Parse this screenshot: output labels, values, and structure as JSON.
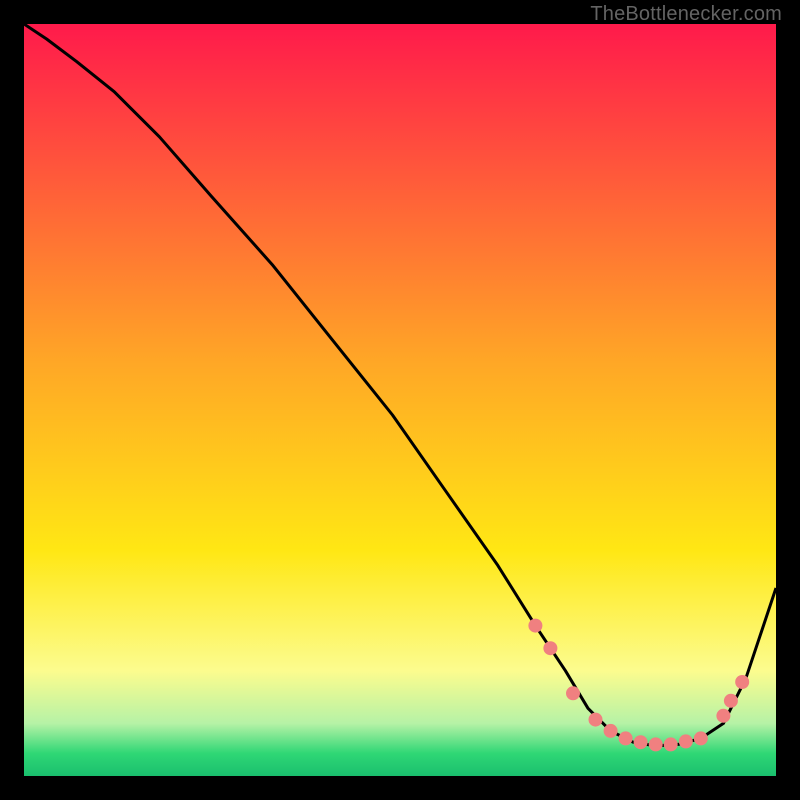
{
  "attribution": "TheBottlenecker.com",
  "chart_data": {
    "type": "line",
    "title": "",
    "xlabel": "",
    "ylabel": "",
    "xlim": [
      0,
      100
    ],
    "ylim": [
      0,
      100
    ],
    "background": {
      "gradient_stops": [
        {
          "pos": 0.0,
          "color": "#ff1a4b"
        },
        {
          "pos": 0.45,
          "color": "#ffa726"
        },
        {
          "pos": 0.7,
          "color": "#ffe714"
        },
        {
          "pos": 0.86,
          "color": "#fcfc8e"
        },
        {
          "pos": 0.93,
          "color": "#b6f2a6"
        },
        {
          "pos": 0.97,
          "color": "#2fd775"
        },
        {
          "pos": 1.0,
          "color": "#1abf6e"
        }
      ]
    },
    "series": [
      {
        "name": "curve",
        "color": "#000000",
        "x": [
          0,
          3,
          7,
          12,
          18,
          25,
          33,
          41,
          49,
          56,
          63,
          68,
          72,
          75,
          78,
          81,
          84,
          87,
          90,
          93,
          96,
          100
        ],
        "y": [
          100,
          98,
          95,
          91,
          85,
          77,
          68,
          58,
          48,
          38,
          28,
          20,
          14,
          9,
          6,
          4.5,
          4,
          4.2,
          5,
          7,
          13,
          25
        ]
      }
    ],
    "markers": [
      {
        "x": 68,
        "y": 20,
        "color": "#f08080"
      },
      {
        "x": 70,
        "y": 17,
        "color": "#f08080"
      },
      {
        "x": 73,
        "y": 11,
        "color": "#f08080"
      },
      {
        "x": 76,
        "y": 7.5,
        "color": "#f08080"
      },
      {
        "x": 78,
        "y": 6,
        "color": "#f08080"
      },
      {
        "x": 80,
        "y": 5,
        "color": "#f08080"
      },
      {
        "x": 82,
        "y": 4.5,
        "color": "#f08080"
      },
      {
        "x": 84,
        "y": 4.2,
        "color": "#f08080"
      },
      {
        "x": 86,
        "y": 4.2,
        "color": "#f08080"
      },
      {
        "x": 88,
        "y": 4.6,
        "color": "#f08080"
      },
      {
        "x": 90,
        "y": 5,
        "color": "#f08080"
      },
      {
        "x": 93,
        "y": 8,
        "color": "#f08080"
      },
      {
        "x": 94,
        "y": 10,
        "color": "#f08080"
      },
      {
        "x": 95.5,
        "y": 12.5,
        "color": "#f08080"
      }
    ]
  }
}
